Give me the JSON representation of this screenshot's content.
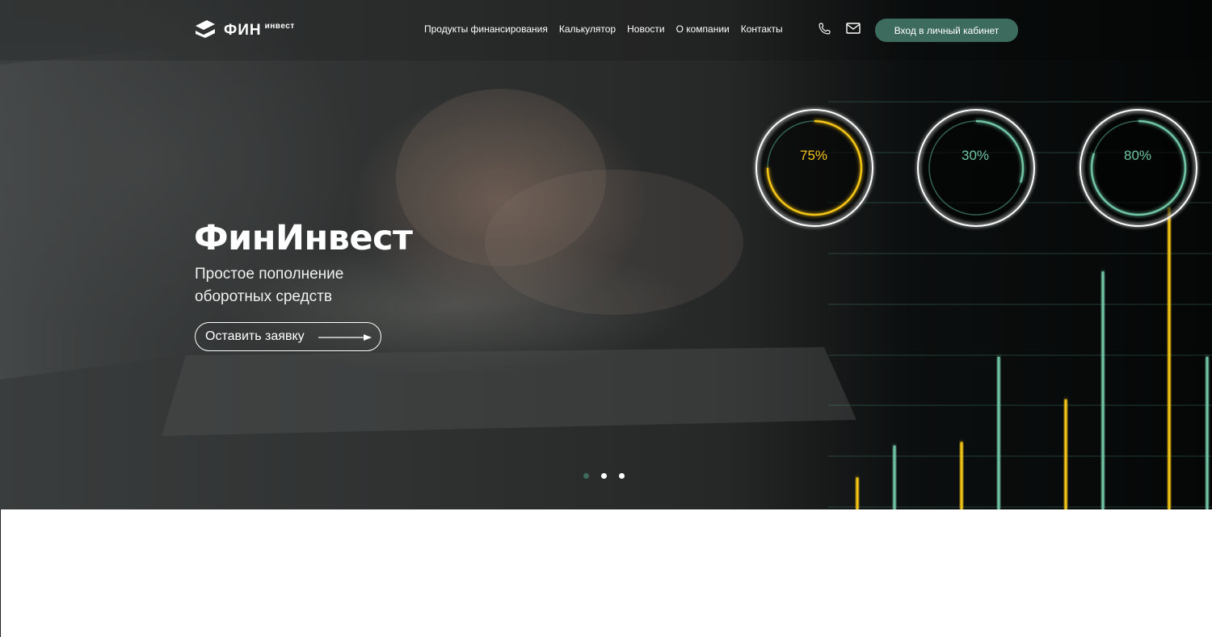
{
  "header": {
    "logo": {
      "main": "ФИН",
      "sup": "инвест"
    },
    "nav": [
      {
        "label": "Продукты финансирования"
      },
      {
        "label": "Калькулятор"
      },
      {
        "label": "Новости"
      },
      {
        "label": "О компании"
      },
      {
        "label": "Контакты"
      }
    ],
    "icons": [
      "phone-icon",
      "mail-icon"
    ],
    "login_label": "Вход в личный кабинет"
  },
  "hero": {
    "title": "ФинИнвест",
    "subtitle": "Простое пополнение оборотных средств",
    "cta_label": "Оставить заявку",
    "slides": {
      "count": 3,
      "active": 1
    }
  },
  "graphic": {
    "rings": [
      {
        "label": "75%",
        "value": 0.75,
        "color": "#f5c518"
      },
      {
        "label": "30%",
        "value": 0.3,
        "color": "#6fc5a5"
      },
      {
        "label": "80%",
        "value": 0.8,
        "color": "#6fc5a5"
      }
    ],
    "bars": [
      {
        "value": 0.09,
        "color": "#f5c518"
      },
      {
        "value": 0.18,
        "color": "#6fc5a5"
      },
      {
        "value": 0.19,
        "color": "#f5c518"
      },
      {
        "value": 0.43,
        "color": "#6fc5a5"
      },
      {
        "value": 0.31,
        "color": "#f5c518"
      },
      {
        "value": 0.67,
        "color": "#6fc5a5"
      },
      {
        "value": 0.85,
        "color": "#f5c518"
      },
      {
        "value": 0.43,
        "color": "#6fc5a5"
      }
    ]
  },
  "colors": {
    "accent": "#3d6b5d",
    "yellow": "#f5c518",
    "teal": "#6fc5a5"
  }
}
